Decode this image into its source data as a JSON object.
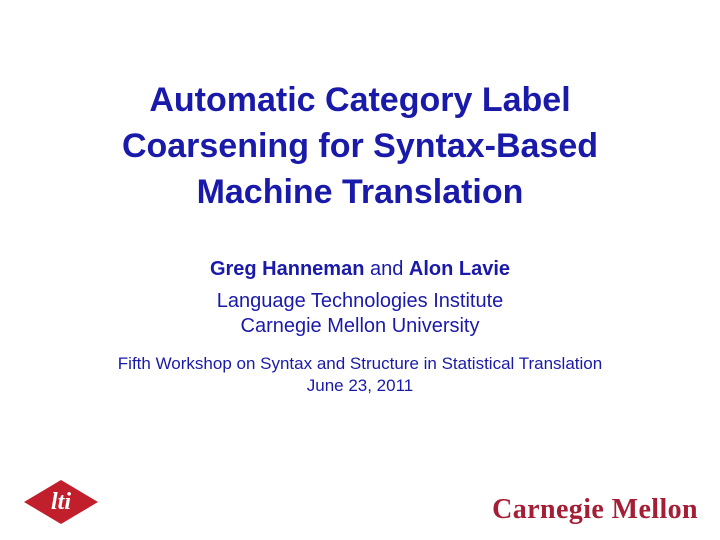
{
  "title": {
    "line1": "Automatic Category Label",
    "line2": "Coarsening for Syntax-Based",
    "line3": "Machine Translation"
  },
  "authors": {
    "name1": "Greg Hanneman",
    "connector": " and ",
    "name2": "Alon Lavie"
  },
  "institution": {
    "line1": "Language Technologies Institute",
    "line2": "Carnegie Mellon University"
  },
  "conference": {
    "line1": "Fifth Workshop on Syntax and Structure in Statistical Translation",
    "date": "June 23, 2011"
  },
  "logos": {
    "lti_text": "lti",
    "cmu_text": "Carnegie Mellon"
  },
  "colors": {
    "title_blue": "#1a1aaa",
    "cmu_red": "#a41f35",
    "lti_red": "#c21f2c"
  }
}
